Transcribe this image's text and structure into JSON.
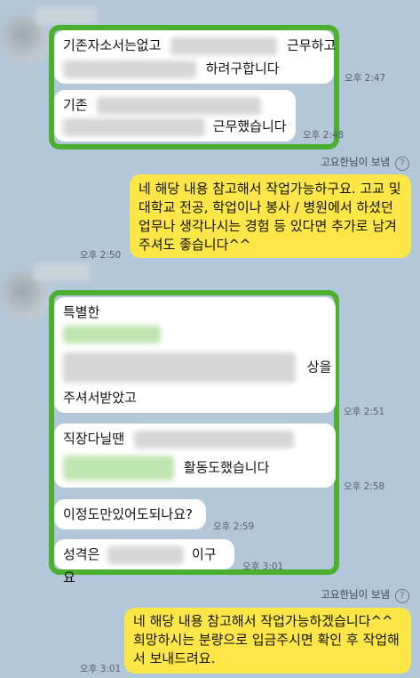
{
  "colors": {
    "background": "#b2c7da",
    "highlight": "#4caf2f",
    "my_bubble": "#fde647",
    "their_bubble": "#ffffff"
  },
  "messages": {
    "m1": {
      "line1_start": "기존자소서는없고",
      "line1_end": "근무하고",
      "line2_end": "하려구합니다",
      "time": "오후 2:47"
    },
    "m2": {
      "line1": "기존",
      "line2_end": "근무했습니다",
      "time": "오후 2:48"
    },
    "sent1": {
      "sender": "고요한님이 보냄",
      "help": "?",
      "text": "네 해당 내용 참고해서 작업가능하구요. 고교 및 대학교 전공, 학업이나 봉사 / 병원에서 하셨던 업무나 생각나시는 경험 등 있다면 추가로 남겨주셔도 좋습니다^^",
      "time": "오후 2:50"
    },
    "m3": {
      "line1": "특별한",
      "line3_end": "상을",
      "line4": "주셔서받았고",
      "time": "오후 2:51"
    },
    "m4": {
      "line1": "직장다닐땐",
      "line2_end": "활동도했습니다",
      "time": "오후 2:58"
    },
    "m5": {
      "text": "이정도만있어도되나요?",
      "time": "오후 2:59"
    },
    "m6": {
      "start": "성격은",
      "end": "이구요",
      "time": "오후 3:01"
    },
    "sent2": {
      "sender": "고요한님이 보냄",
      "help": "?",
      "text": "네 해당 내용 참고해서 작업가능하겠습니다^^ 희망하시는 분량으로 입금주시면 확인 후 작업해서 보내드려요.",
      "time": "오후 3:01"
    }
  }
}
